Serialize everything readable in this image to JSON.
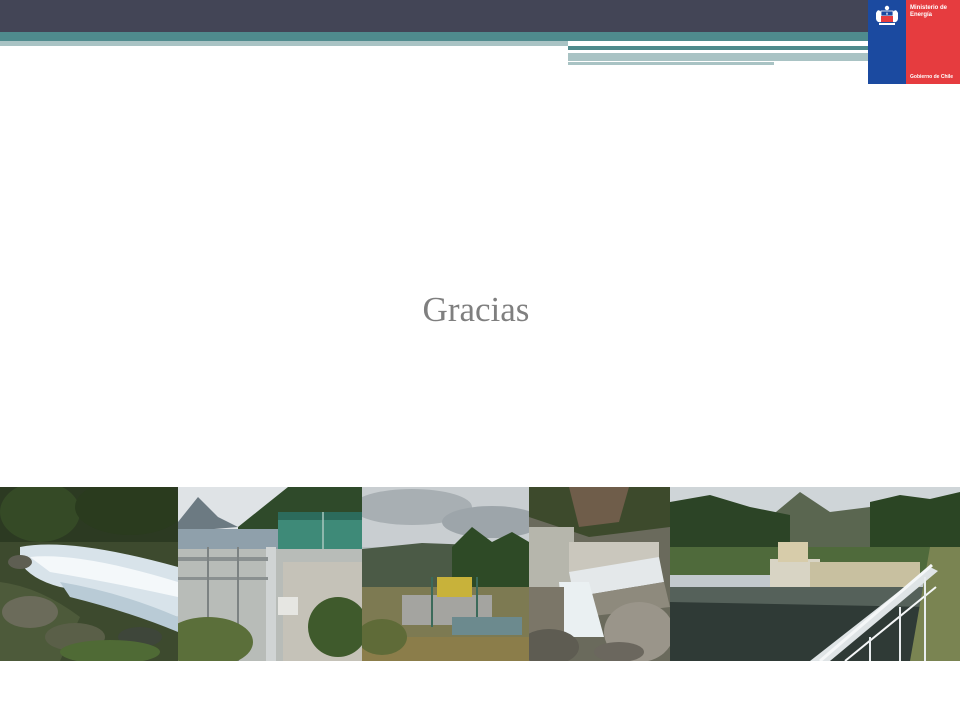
{
  "slide": {
    "title": "Gracias"
  },
  "logo": {
    "line1": "Ministerio de",
    "line2": "Energía",
    "line3": "Gobierno de Chile"
  },
  "photos": [
    {
      "name": "river-rapids-photo"
    },
    {
      "name": "hydro-plant-building-photo"
    },
    {
      "name": "water-intake-gate-photo"
    },
    {
      "name": "concrete-weir-photo"
    },
    {
      "name": "reservoir-dam-photo"
    }
  ],
  "colors": {
    "topbar": "#434556",
    "accent": "#4f8b8d",
    "accent_light": "#a9c3c4",
    "logo_blue": "#1b4aa0",
    "logo_red": "#e63c3f",
    "title": "#7f7f7f"
  }
}
